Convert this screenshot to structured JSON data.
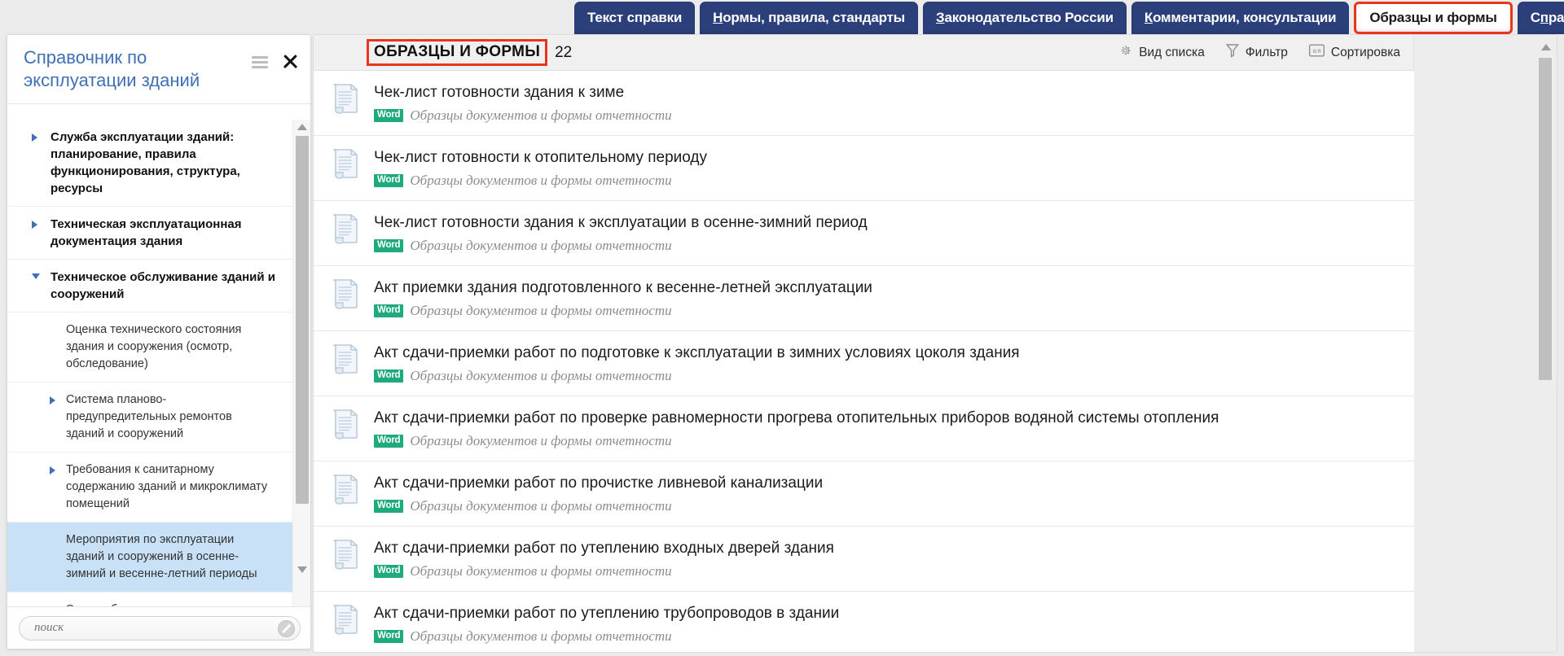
{
  "tabs": [
    {
      "label": "Текст справки",
      "accel": "",
      "active": false,
      "name": "tab-tekst-spravki"
    },
    {
      "label": "Нормы, правила, стандарты",
      "accel": "Н",
      "active": false,
      "name": "tab-normy-pravila-standarty"
    },
    {
      "label": "Законодательство России",
      "accel": "З",
      "active": false,
      "name": "tab-zakonodatelstvo-rossii"
    },
    {
      "label": "Комментарии, консультации",
      "accel": "К",
      "active": false,
      "name": "tab-kommentarii-konsultacii"
    },
    {
      "label": "Образцы и формы",
      "accel": "",
      "active": true,
      "name": "tab-obrazcy-i-formy"
    },
    {
      "label": "Справки",
      "accel": "п",
      "active": false,
      "name": "tab-spravki"
    }
  ],
  "sidebar": {
    "title": "Справочник по эксплуатации зданий",
    "menu_icon": "hamburger-icon",
    "close_icon": "close-icon",
    "search": {
      "value": "",
      "placeholder": "поиск",
      "clear_icon": "clear-icon"
    },
    "tree": [
      {
        "label": "Служба эксплуатации зданий: планирование, правила функционирования, структура, ресурсы",
        "level": 1,
        "arrow": "right",
        "selected": false
      },
      {
        "label": "Техническая эксплуатационная документация здания",
        "level": 1,
        "arrow": "right",
        "selected": false
      },
      {
        "label": "Техническое обслуживание зданий и сооружений",
        "level": 1,
        "arrow": "down",
        "selected": false
      },
      {
        "label": "Оценка технического состояния здания и сооружения (осмотр, обследование)",
        "level": 2,
        "arrow": "none",
        "selected": false
      },
      {
        "label": "Система планово-предупредительных ремонтов зданий и сооружений",
        "level": 2,
        "arrow": "right",
        "selected": false
      },
      {
        "label": "Требования к санитарному содержанию зданий и микроклимату помещений",
        "level": 2,
        "arrow": "right",
        "selected": false
      },
      {
        "label": "Мероприятия по эксплуатации зданий и сооружений в осенне-зимний и весенне-летний периоды",
        "level": 2,
        "arrow": "none",
        "selected": true
      },
      {
        "label": "Энергосбережение при эксплуатации зданий и сооружений",
        "level": 2,
        "arrow": "none",
        "selected": false
      }
    ]
  },
  "main": {
    "header": {
      "title": "ОБРАЗЦЫ И ФОРМЫ",
      "count": "22",
      "tools": [
        {
          "label": "Вид списка",
          "icon": "gear-icon",
          "name": "list-view-button"
        },
        {
          "label": "Фильтр",
          "icon": "filter-icon",
          "name": "filter-button"
        },
        {
          "label": "Сортировка",
          "icon": "sort-icon",
          "name": "sort-button"
        }
      ]
    },
    "documents": [
      {
        "title": "Чек-лист готовности здания к зиме",
        "badge": "Word",
        "source": "Образцы документов и формы отчетности"
      },
      {
        "title": "Чек-лист готовности к отопительному периоду",
        "badge": "Word",
        "source": "Образцы документов и формы отчетности"
      },
      {
        "title": "Чек-лист готовности здания к эксплуатации в осенне-зимний период",
        "badge": "Word",
        "source": "Образцы документов и формы отчетности"
      },
      {
        "title": "Акт приемки здания подготовленного к весенне-летней эксплуатации",
        "badge": "Word",
        "source": "Образцы документов и формы отчетности"
      },
      {
        "title": "Акт сдачи-приемки работ по подготовке к эксплуатации в зимних условиях цоколя здания",
        "badge": "Word",
        "source": "Образцы документов и формы отчетности"
      },
      {
        "title": "Акт сдачи-приемки работ по проверке равномерности прогрева отопительных приборов водяной системы отопления",
        "badge": "Word",
        "source": "Образцы документов и формы отчетности"
      },
      {
        "title": "Акт сдачи-приемки работ по прочистке ливневой канализации",
        "badge": "Word",
        "source": "Образцы документов и формы отчетности"
      },
      {
        "title": "Акт сдачи-приемки работ по утеплению входных дверей здания",
        "badge": "Word",
        "source": "Образцы документов и формы отчетности"
      },
      {
        "title": "Акт сдачи-приемки работ по утеплению трубопроводов в здании",
        "badge": "Word",
        "source": "Образцы документов и формы отчетности"
      }
    ]
  },
  "colors": {
    "tab_bg": "#2b3f7a",
    "accent_red": "#e8351d",
    "badge_green": "#1faa7d",
    "selection_blue": "#c9e1f7",
    "sidebar_title": "#3f6fb5"
  }
}
